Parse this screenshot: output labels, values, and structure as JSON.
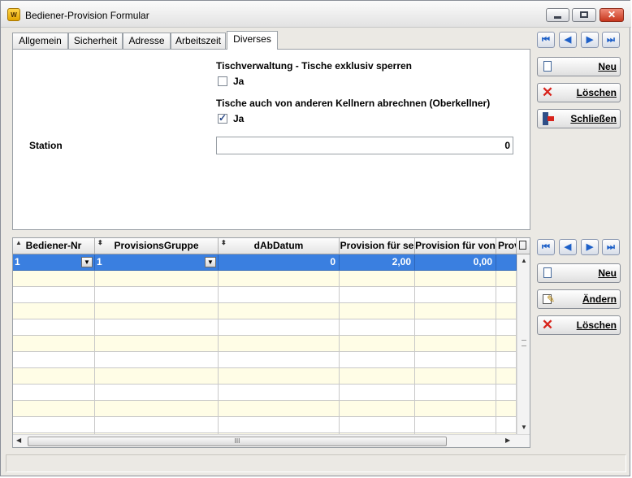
{
  "window": {
    "title": "Bediener-Provision Formular",
    "app_icon_text": "W",
    "controls": {
      "minimize_icon": "minimize-icon",
      "maximize_icon": "maximize-icon",
      "close_label": "✕"
    }
  },
  "tabs": [
    {
      "label": "Allgemein",
      "active": false
    },
    {
      "label": "Sicherheit",
      "active": false
    },
    {
      "label": "Adresse",
      "active": false
    },
    {
      "label": "Arbeitszeit",
      "active": false
    },
    {
      "label": "Diverses",
      "active": true
    }
  ],
  "form": {
    "tischverwaltung_label": "Tischverwaltung - Tische exklusiv sperren",
    "tischverwaltung_checkbox_label": "Ja",
    "tischverwaltung_checked": false,
    "oberkellner_label": "Tische auch von anderen Kellnern abrechnen (Oberkellner)",
    "oberkellner_checkbox_label": "Ja",
    "oberkellner_checked": true,
    "station_label": "Station",
    "station_value": "0"
  },
  "top_nav": {
    "first": "⏮",
    "prev": "◀",
    "next": "▶",
    "last": "⏭"
  },
  "top_buttons": {
    "neu": "Neu",
    "loeschen": "Löschen",
    "schliessen": "Schließen"
  },
  "grid": {
    "columns": [
      "Bediener-Nr",
      "ProvisionsGruppe",
      "dAbDatum",
      "Provision für se",
      "Provision für von",
      "Prov"
    ],
    "selected_row": [
      "1",
      "1",
      "0",
      "2,00",
      "0,00",
      ""
    ],
    "empty_rows": 11,
    "hscroll_label": "III"
  },
  "bottom_nav": {
    "first": "⏮",
    "prev": "◀",
    "next": "▶",
    "last": "⏭"
  },
  "bottom_buttons": {
    "neu": "Neu",
    "aendern": "Ändern",
    "loeschen": "Löschen"
  },
  "colors": {
    "selection": "#3a7fe0",
    "alt_row": "#fffde6",
    "nav_arrow": "#1e60c8",
    "delete_x": "#d8241c"
  }
}
